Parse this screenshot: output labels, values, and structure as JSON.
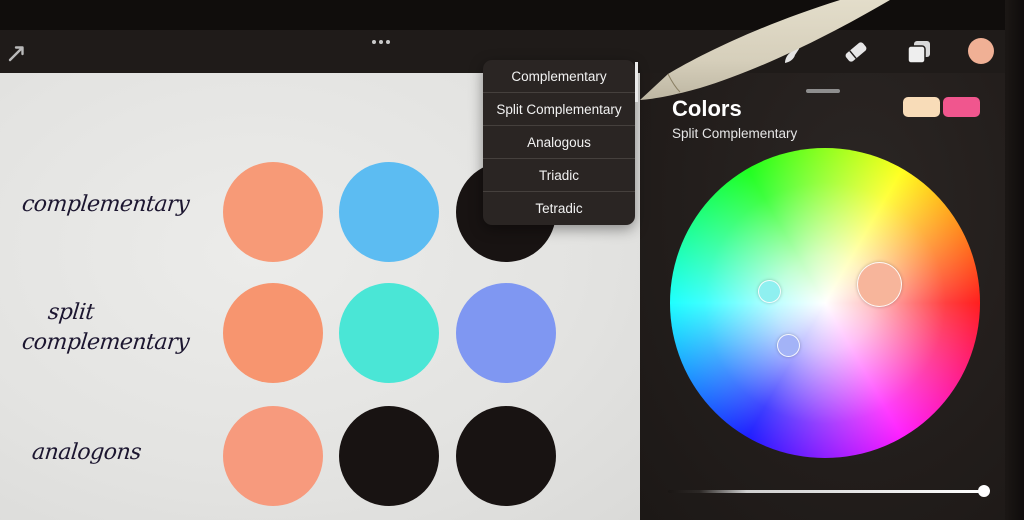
{
  "toolbar": {
    "left_icons": [
      "arrow-icon"
    ],
    "center_icons": [
      "more-icon"
    ],
    "right_icons": [
      "smudge-icon",
      "eraser-icon",
      "layers-icon",
      "color-dot"
    ],
    "active_color": "#f0b095"
  },
  "canvas": {
    "rows": [
      {
        "label": "complementary",
        "colors": [
          "#f79a77",
          "#5cbcf2",
          "#181312"
        ]
      },
      {
        "label_line1": "split",
        "label_line2": "complementary",
        "colors": [
          "#f7956f",
          "#4ae6d6",
          "#7f97f2"
        ]
      },
      {
        "label": "analogons",
        "colors": [
          "#f79a7d",
          "#181312",
          "#181312"
        ]
      }
    ]
  },
  "harmony_menu": {
    "items": [
      {
        "label": "Complementary"
      },
      {
        "label": "Split Complementary"
      },
      {
        "label": "Analogous"
      },
      {
        "label": "Triadic"
      },
      {
        "label": "Tetradic"
      }
    ],
    "selected": "Split Complementary"
  },
  "colors_panel": {
    "title": "Colors",
    "mode": "Split Complementary",
    "primary_swatch": "#f8dcb8",
    "secondary_swatch": "#f0568e",
    "handles": [
      {
        "role": "primary",
        "color": "#f7b59b"
      },
      {
        "role": "split-1",
        "color": "#8ff0f0"
      },
      {
        "role": "split-2",
        "color": "#a3b3f7"
      }
    ],
    "brightness_value": 1.0
  }
}
